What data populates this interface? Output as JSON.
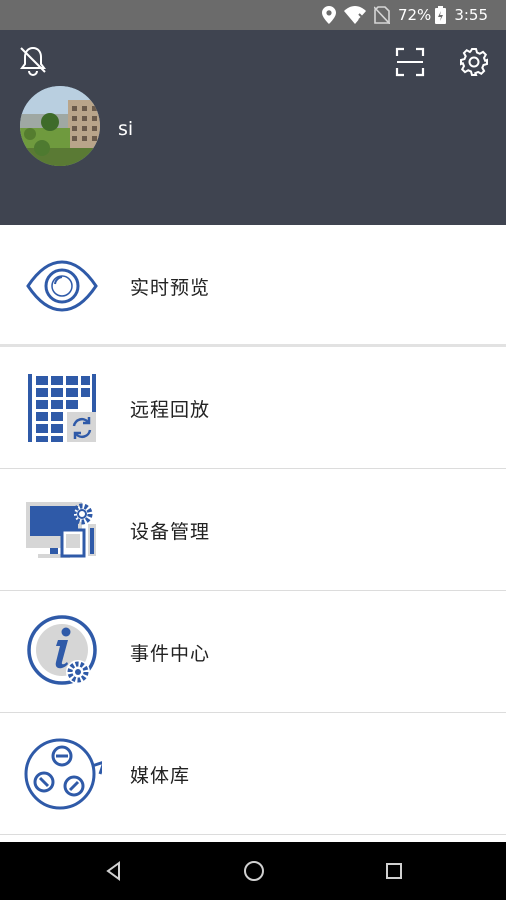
{
  "status_bar": {
    "battery": "72%",
    "time": "3:55",
    "icons": [
      "location-icon",
      "wifi-icon",
      "no-sim-icon",
      "battery-icon"
    ]
  },
  "header": {
    "username": "si",
    "icons": [
      "bell-off-icon",
      "scan-icon",
      "gear-icon"
    ]
  },
  "menu": {
    "items": [
      {
        "label": "实时预览",
        "icon": "eye-icon"
      },
      {
        "label": "远程回放",
        "icon": "playback-grid-icon"
      },
      {
        "label": "设备管理",
        "icon": "device-monitor-icon"
      },
      {
        "label": "事件中心",
        "icon": "info-gear-icon"
      },
      {
        "label": "媒体库",
        "icon": "film-reel-icon"
      }
    ]
  },
  "nav_bar": {
    "buttons": [
      "back-icon",
      "home-icon",
      "recents-icon"
    ]
  },
  "colors": {
    "header_bg": "#3f4450",
    "status_bg": "#6b6b6b",
    "icon_blue": "#2f5aa8",
    "divider": "#dcdcdc"
  }
}
